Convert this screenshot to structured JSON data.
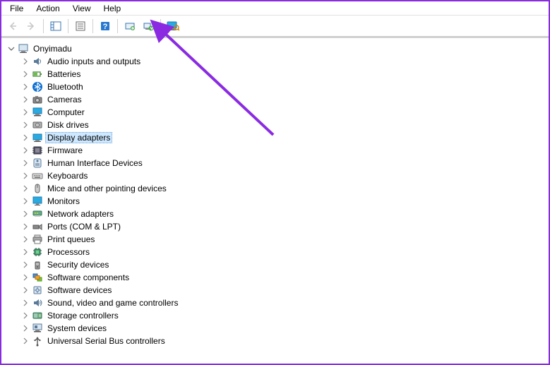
{
  "menu": {
    "file": "File",
    "action": "Action",
    "view": "View",
    "help": "Help"
  },
  "toolbar": {
    "back": "back-icon",
    "forward": "forward-icon",
    "show_hide": "show-hide-tree-icon",
    "properties": "properties-icon",
    "help": "help-icon",
    "update": "update-driver-icon",
    "uninstall": "uninstall-device-icon",
    "scan": "scan-hardware-icon"
  },
  "tree": {
    "root": "Onyimadu",
    "selected": "Display adapters",
    "items": [
      {
        "label": "Audio inputs and outputs",
        "icon": "audio-icon"
      },
      {
        "label": "Batteries",
        "icon": "battery-icon"
      },
      {
        "label": "Bluetooth",
        "icon": "bluetooth-icon"
      },
      {
        "label": "Cameras",
        "icon": "camera-icon"
      },
      {
        "label": "Computer",
        "icon": "computer-icon"
      },
      {
        "label": "Disk drives",
        "icon": "disk-icon"
      },
      {
        "label": "Display adapters",
        "icon": "display-adapter-icon"
      },
      {
        "label": "Firmware",
        "icon": "firmware-icon"
      },
      {
        "label": "Human Interface Devices",
        "icon": "hid-icon"
      },
      {
        "label": "Keyboards",
        "icon": "keyboard-icon"
      },
      {
        "label": "Mice and other pointing devices",
        "icon": "mouse-icon"
      },
      {
        "label": "Monitors",
        "icon": "monitor-icon"
      },
      {
        "label": "Network adapters",
        "icon": "network-icon"
      },
      {
        "label": "Ports (COM & LPT)",
        "icon": "port-icon"
      },
      {
        "label": "Print queues",
        "icon": "printer-icon"
      },
      {
        "label": "Processors",
        "icon": "processor-icon"
      },
      {
        "label": "Security devices",
        "icon": "security-icon"
      },
      {
        "label": "Software components",
        "icon": "software-component-icon"
      },
      {
        "label": "Software devices",
        "icon": "software-device-icon"
      },
      {
        "label": "Sound, video and game controllers",
        "icon": "sound-icon"
      },
      {
        "label": "Storage controllers",
        "icon": "storage-icon"
      },
      {
        "label": "System devices",
        "icon": "system-icon"
      },
      {
        "label": "Universal Serial Bus controllers",
        "icon": "usb-icon"
      }
    ]
  },
  "colors": {
    "accent": "#8a2be2",
    "selection": "#cde8ff"
  }
}
